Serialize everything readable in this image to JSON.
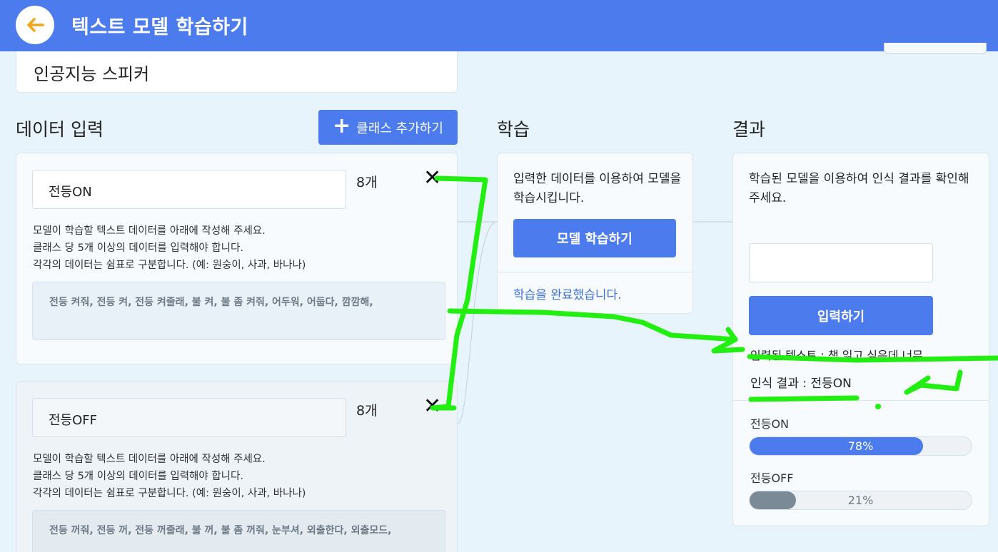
{
  "header": {
    "title": "텍스트 모델 학습하기",
    "back_icon": "arrow-left-icon",
    "accent_color": "#4b7bec"
  },
  "model_name": "인공지능 스피커",
  "data_section": {
    "title": "데이터 입력",
    "add_class_label": "클래스 추가하기",
    "classes": [
      {
        "name": "전등ON",
        "count": "8개",
        "help": [
          "모델이 학습할 텍스트 데이터를 아래에 작성해 주세요.",
          "클래스 당 5개 이상의 데이터를 입력해야 합니다.",
          "각각의 데이터는 쉼표로 구분합니다. (예: 원숭이, 사과, 바나나)"
        ],
        "data": "전등 켜줘, 전등 켜, 전등 켜줄래, 불 켜, 불 좀 켜줘, 어두워, 어둡다, 깜깜해,"
      },
      {
        "name": "전등OFF",
        "count": "8개",
        "help": [
          "모델이 학습할 텍스트 데이터를 아래에 작성해 주세요.",
          "클래스 당 5개 이상의 데이터를 입력해야 합니다.",
          "각각의 데이터는 쉼표로 구분합니다. (예: 원숭이, 사과, 바나나)"
        ],
        "data": "전등 꺼줘, 전등 꺼, 전등 꺼줄래, 불 꺼, 불 좀 꺼줘, 눈부셔, 외출한다, 외출모드,"
      }
    ]
  },
  "train_section": {
    "title": "학습",
    "description": "입력한 데이터를 이용하여 모델을 학습시킵니다.",
    "train_button": "모델 학습하기",
    "status": "학습을 완료했습니다."
  },
  "result_section": {
    "title": "결과",
    "description": "학습된 모델을 이용하여 인식 결과를 확인해주세요.",
    "input_value": "",
    "submit_button": "입력하기",
    "entered_text": "입력된 텍스트 : 책 읽고 싶은데 너무 ...",
    "recognized": "인식 결과 : 전등ON",
    "probabilities": [
      {
        "label": "전등ON",
        "percent_text": "78%",
        "value": 0.78,
        "color": "#4b7bec"
      },
      {
        "label": "전등OFF",
        "percent_text": "21%",
        "value": 0.21,
        "color": "#7b8a97"
      }
    ]
  }
}
